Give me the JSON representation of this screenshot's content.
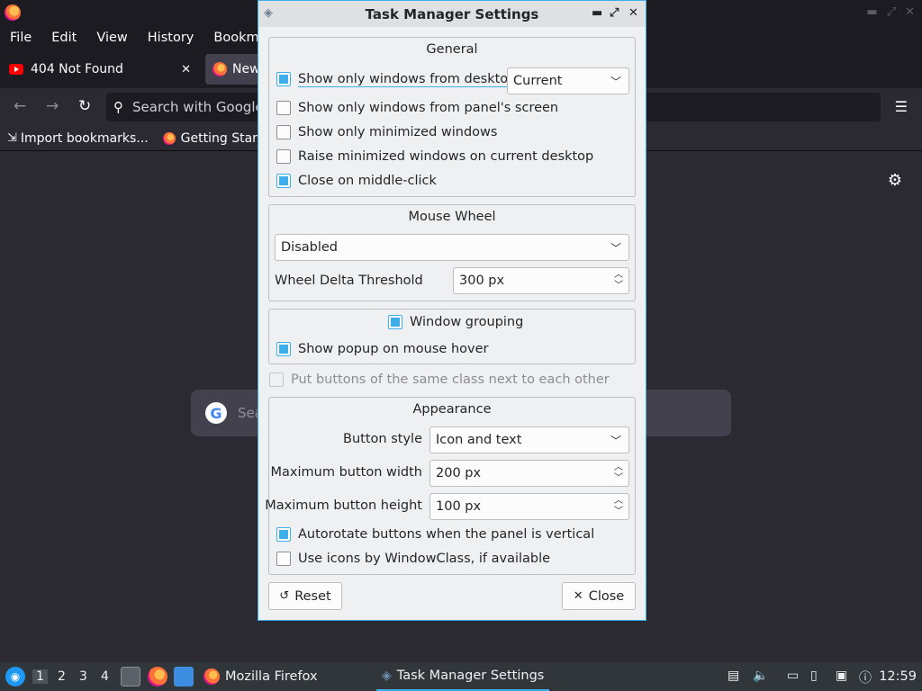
{
  "firefox": {
    "menu": [
      "File",
      "Edit",
      "View",
      "History",
      "Bookmar"
    ],
    "tabs": [
      {
        "label": "404 Not Found",
        "close": "✕"
      },
      {
        "label": "New"
      }
    ],
    "nav": {
      "back": "←",
      "forward": "→",
      "reload": "↻"
    },
    "urlbar_placeholder": "Search with Google",
    "bookmarks": [
      "Import bookmarks...",
      "Getting Start"
    ],
    "newtab_search_placeholder": "Sea"
  },
  "dialog": {
    "title": "Task Manager Settings",
    "controls": {
      "minimize": "▬",
      "maximize": "⤢",
      "close": "✕"
    },
    "general": {
      "title": "General",
      "show_only_desktop": {
        "label": "Show only windows from desktop",
        "checked": true
      },
      "desktop_combo": "Current",
      "show_only_panel_screen": {
        "label": "Show only windows from panel's screen",
        "checked": false
      },
      "show_only_minimized": {
        "label": "Show only minimized windows",
        "checked": false
      },
      "raise_minimized": {
        "label": "Raise minimized windows on current desktop",
        "checked": false
      },
      "close_middle_click": {
        "label": "Close on middle-click",
        "checked": true
      }
    },
    "mouse_wheel": {
      "title": "Mouse Wheel",
      "mode_combo": "Disabled",
      "threshold_label": "Wheel Delta Threshold",
      "threshold_value": "300 px"
    },
    "grouping": {
      "window_grouping": {
        "label": "Window grouping",
        "checked": true
      },
      "popup_hover": {
        "label": "Show popup on mouse hover",
        "checked": true
      }
    },
    "same_class": {
      "label": "Put buttons of the same class next to each other",
      "checked": false,
      "disabled": true
    },
    "appearance": {
      "title": "Appearance",
      "button_style_label": "Button style",
      "button_style_value": "Icon and text",
      "max_width_label": "Maximum button width",
      "max_width_value": "200 px",
      "max_height_label": "Maximum button height",
      "max_height_value": "100 px",
      "autorotate": {
        "label": "Autorotate buttons when the panel is vertical",
        "checked": true
      },
      "use_icons": {
        "label": "Use icons by WindowClass, if available",
        "checked": false
      }
    },
    "buttons": {
      "reset": "Reset",
      "close": "Close"
    }
  },
  "taskbar": {
    "desktops": [
      "1",
      "2",
      "3",
      "4"
    ],
    "active_desktop": "1",
    "tasks": [
      {
        "label": "Mozilla Firefox",
        "active": false
      },
      {
        "label": "Task Manager Settings",
        "active": true
      }
    ],
    "clock": "12:59"
  },
  "colors": {
    "accent": "#3daee9",
    "dialog_bg": "#eff0f1",
    "firefox_bg": "#2b2a33",
    "taskbar_bg": "#31363b"
  }
}
